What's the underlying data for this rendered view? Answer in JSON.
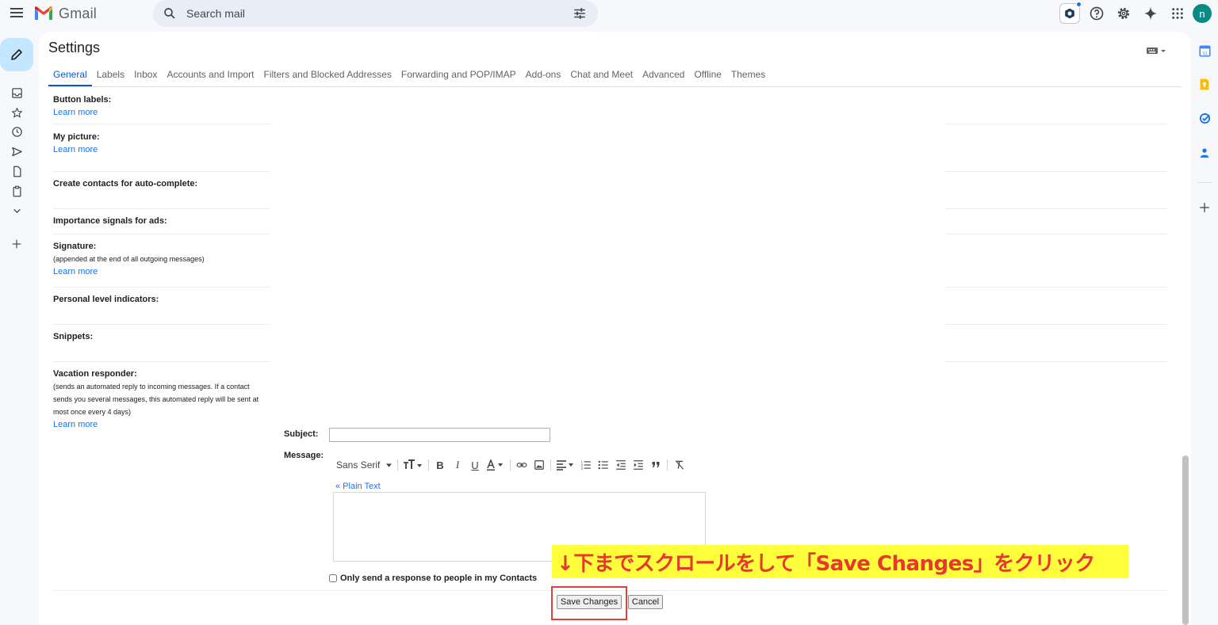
{
  "app": {
    "name": "Gmail"
  },
  "search": {
    "placeholder": "Search mail"
  },
  "avatar": {
    "initial": "n",
    "color": "#0b8a84"
  },
  "settings": {
    "title": "Settings",
    "tabs": [
      "General",
      "Labels",
      "Inbox",
      "Accounts and Import",
      "Filters and Blocked Addresses",
      "Forwarding and POP/IMAP",
      "Add-ons",
      "Chat and Meet",
      "Advanced",
      "Offline",
      "Themes"
    ],
    "active_tab": "General"
  },
  "rows": {
    "button_labels": {
      "label": "Button labels:",
      "link": "Learn more"
    },
    "my_picture": {
      "label": "My picture:",
      "link": "Learn more"
    },
    "create_contacts": {
      "label": "Create contacts for auto-complete:"
    },
    "importance_signals": {
      "label": "Importance signals for ads:"
    },
    "signature": {
      "label": "Signature:",
      "sub": "(appended at the end of all outgoing messages)",
      "link": "Learn more"
    },
    "personal_level": {
      "label": "Personal level indicators:"
    },
    "snippets": {
      "label": "Snippets:"
    },
    "vacation": {
      "label": "Vacation responder:",
      "sub1": "(sends an automated reply to incoming messages. If a contact",
      "sub2": "sends you several messages, this automated reply will be sent at",
      "sub3": "most once every 4 days)",
      "link": "Learn more"
    }
  },
  "vacation_form": {
    "subject_label": "Subject:",
    "subject_value": "",
    "message_label": "Message:",
    "font_name": "Sans Serif",
    "plain_text_link": "« Plain Text",
    "message_value": "",
    "contacts_only_label": "Only send a response to people in my Contacts",
    "contacts_only_checked": false,
    "save_label": "Save Changes",
    "cancel_label": "Cancel"
  },
  "annotation": {
    "text": "↓下までスクロールをして「Save Changes」をクリック",
    "background": "#ffff3b",
    "color": "#e8372f"
  }
}
